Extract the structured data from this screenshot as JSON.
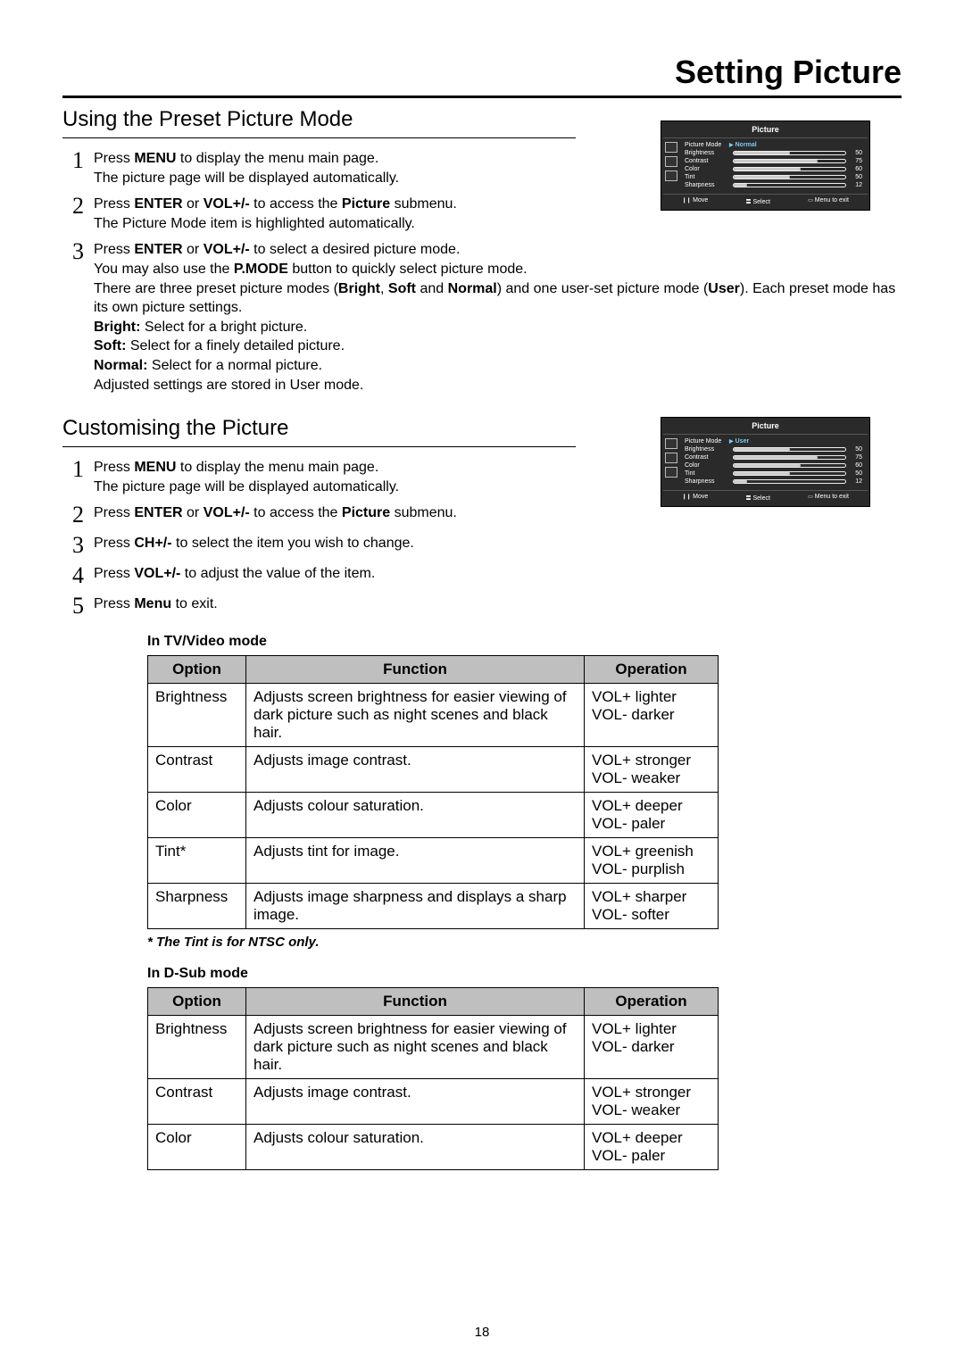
{
  "title": "Setting Picture",
  "page_number": "18",
  "section1": {
    "heading": "Using the Preset Picture Mode",
    "steps": [
      {
        "n": "1",
        "html": "Press <b>MENU</b> to display the menu main page.<br>The picture page will be displayed automatically."
      },
      {
        "n": "2",
        "html": "Press <b>ENTER</b> or <b>VOL+/-</b> to access the <b>Picture</b> submenu.<br>The Picture Mode item is highlighted automatically."
      },
      {
        "n": "3",
        "html": "Press <b>ENTER</b> or <b>VOL+/-</b> to select a desired picture mode.<br>You may also use the <b>P.MODE</b> button to quickly select picture mode.<br>There are three preset picture modes (<b>Bright</b>, <b>Soft</b> and <b>Normal</b>) and one user-set picture mode (<b>User</b>). Each preset mode has its own picture settings.<br><b>Bright:</b> Select for a bright picture.<br><b>Soft:</b> Select for a finely detailed picture.<br><b>Normal:</b> Select for a normal picture.<br>Adjusted settings are stored in User mode."
      }
    ]
  },
  "section2": {
    "heading": "Customising the Picture",
    "steps": [
      {
        "n": "1",
        "html": "Press <b>MENU</b> to display the menu main page.<br>The picture page will be displayed automatically."
      },
      {
        "n": "2",
        "html": "Press <b>ENTER</b> or <b>VOL+/-</b> to access the <b>Picture</b> submenu."
      },
      {
        "n": "3",
        "html": "Press <b>CH+/-</b> to select the item you wish to change."
      },
      {
        "n": "4",
        "html": "Press <b>VOL+/-</b> to adjust the value of the item."
      },
      {
        "n": "5",
        "html": "Press <b>Menu</b> to exit."
      }
    ]
  },
  "osd": {
    "title": "Picture",
    "footer": {
      "move": "Move",
      "select": "Select",
      "exit": "Menu to exit"
    },
    "menu1_mode": "Normal",
    "menu2_mode": "User",
    "rows": [
      {
        "label": "Brightness",
        "value": 50
      },
      {
        "label": "Contrast",
        "value": 75
      },
      {
        "label": "Color",
        "value": 60
      },
      {
        "label": "Tint",
        "value": 50
      },
      {
        "label": "Sharpness",
        "value": 12
      }
    ]
  },
  "table1": {
    "caption": "In TV/Video mode",
    "headers": [
      "Option",
      "Function",
      "Operation"
    ],
    "rows": [
      [
        "Brightness",
        "Adjusts screen brightness for easier viewing of dark picture such as night scenes and black hair.",
        "VOL+ lighter\nVOL- darker"
      ],
      [
        "Contrast",
        "Adjusts image contrast.",
        "VOL+ stronger\nVOL- weaker"
      ],
      [
        "Color",
        "Adjusts colour saturation.",
        "VOL+ deeper\nVOL- paler"
      ],
      [
        "Tint*",
        "Adjusts tint for image.",
        "VOL+ greenish\nVOL- purplish"
      ],
      [
        "Sharpness",
        "Adjusts image sharpness and displays a sharp image.",
        "VOL+ sharper\nVOL- softer"
      ]
    ],
    "note": "* The Tint is for NTSC only."
  },
  "table2": {
    "caption": "In D-Sub mode",
    "headers": [
      "Option",
      "Function",
      "Operation"
    ],
    "rows": [
      [
        "Brightness",
        "Adjusts screen brightness for easier viewing of dark picture such as night scenes and black hair.",
        "VOL+ lighter\nVOL- darker"
      ],
      [
        "Contrast",
        "Adjusts image contrast.",
        "VOL+ stronger\nVOL- weaker"
      ],
      [
        "Color",
        "Adjusts colour saturation.",
        "VOL+ deeper\nVOL- paler"
      ]
    ]
  }
}
